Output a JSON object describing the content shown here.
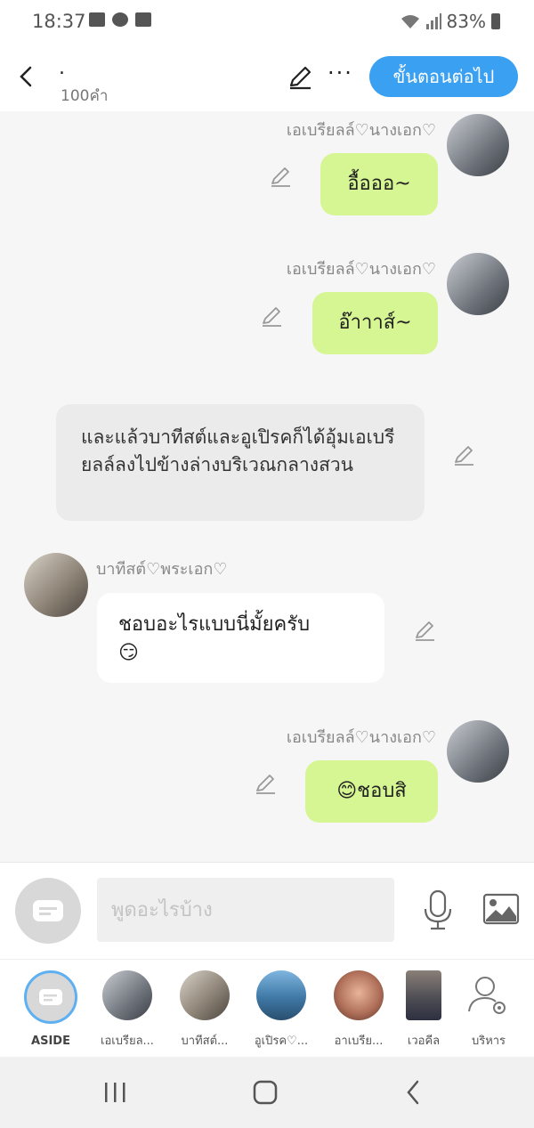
{
  "status": {
    "time": "18:37",
    "battery": "83%"
  },
  "header": {
    "title": ".",
    "subtitle": "100คำ",
    "next_label": "ขั้นตอนต่อไป",
    "more_label": "···"
  },
  "messages": [
    {
      "name": "เอเบรียลล์♡นางเอก♡",
      "text": "อื้อออ~"
    },
    {
      "name": "เอเบรียลล์♡นางเอก♡",
      "text": "อ๊าาาส์~"
    },
    {
      "narration": "และแล้วบาทีสต์และอูเปิรคก็ได้อุ้มเอเบรียลล์ลงไปข้างล่างบริเวณกลางสวน"
    },
    {
      "name": "บาทีสต์♡พระเอก♡",
      "text": "ชอบอะไรแบบนี่มั้ยครับ",
      "emoji": "😏"
    },
    {
      "name": "เอเบรียลล์♡นางเอก♡",
      "text": "😊ชอบสิ"
    }
  ],
  "input": {
    "placeholder": "พูดอะไรบ้าง"
  },
  "characters": [
    {
      "label": "ASIDE",
      "color": "#d8d8d8"
    },
    {
      "label": "เอเบรียล...",
      "color": "#8a8f96"
    },
    {
      "label": "บาทีสต์...",
      "color": "#9b8b7a"
    },
    {
      "label": "อูเปิรค♡...",
      "color": "#4a7fa8"
    },
    {
      "label": "อาเบรีย...",
      "color": "#b0705a"
    },
    {
      "label": "เวอคีล",
      "color": "#6a6a70"
    },
    {
      "label": "บริหาร",
      "color": "#ffffff"
    }
  ],
  "colors": {
    "accent": "#3aa0f2",
    "green_bubble": "#d6f693",
    "narration": "#ebebeb"
  }
}
